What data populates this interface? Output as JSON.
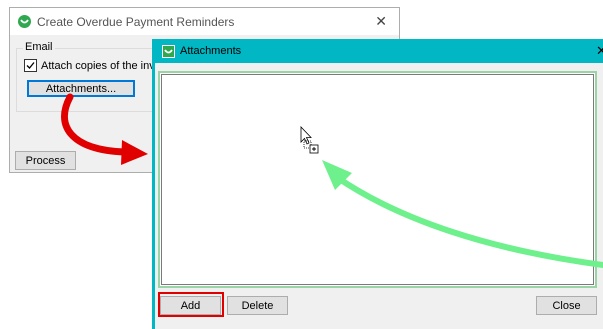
{
  "main_dialog": {
    "title": "Create Overdue Payment Reminders",
    "close_glyph": "✕",
    "group_label": "Email",
    "attach_checkbox": {
      "label": "Attach copies of the invoices",
      "checked": true
    },
    "attachments_button": "Attachments...",
    "process_button": "Process"
  },
  "attachments_dialog": {
    "title": "Attachments",
    "close_glyph": "✕",
    "titlebar_color": "#00b7c3",
    "add_button": "Add",
    "delete_button": "Delete",
    "close_button": "Close"
  },
  "annotations": {
    "red_arrow_color": "#e00000",
    "green_arrow_color": "#6ef08c",
    "highlight_color": "#e00000"
  },
  "icons": {
    "app": "app-logo-icon",
    "cursor": "drag-copy-cursor-icon",
    "check": "checkmark-icon"
  }
}
